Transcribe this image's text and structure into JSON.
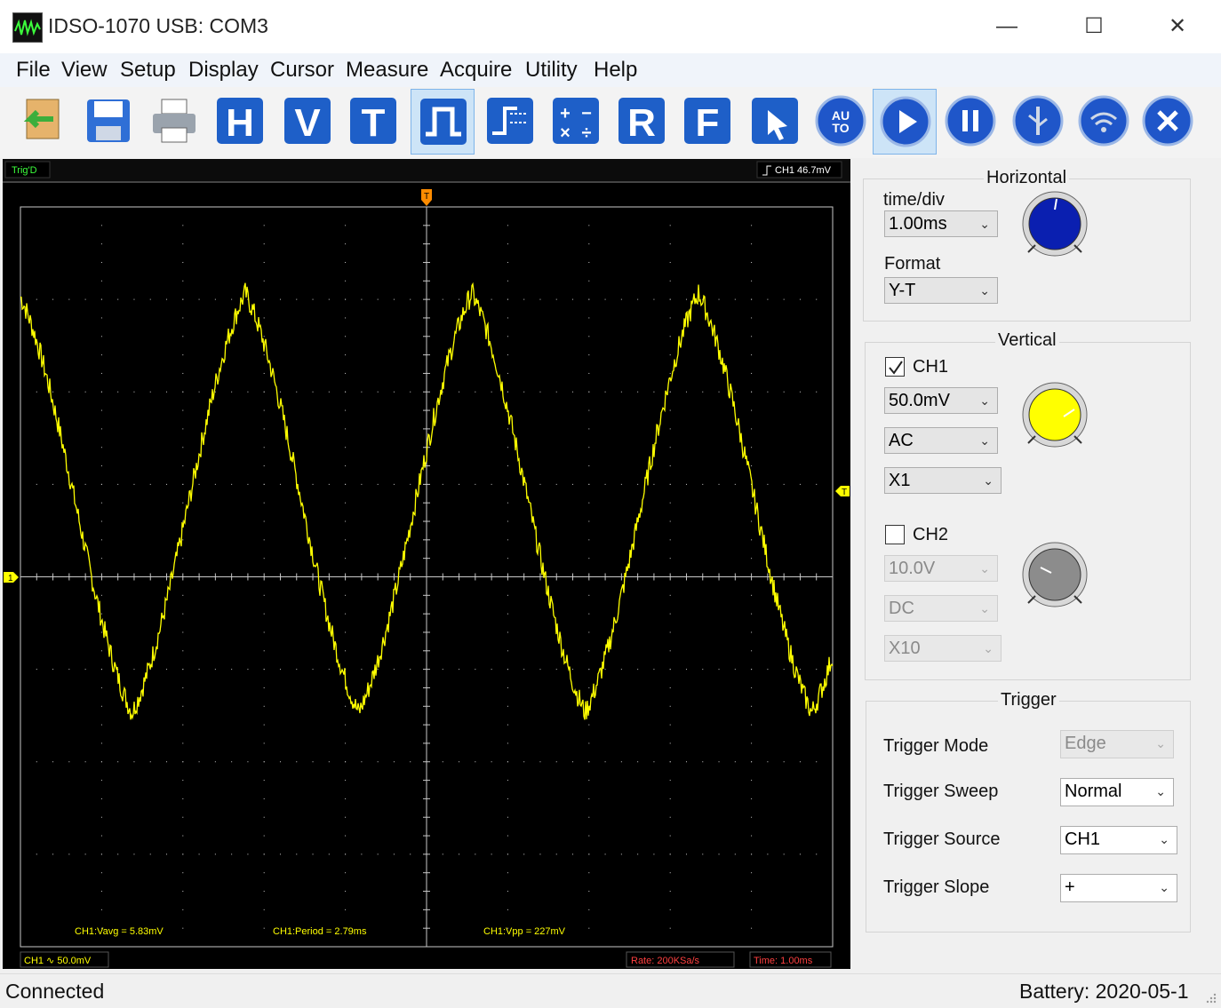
{
  "window": {
    "title": "IDSO-1070  USB: COM3",
    "minimize": "—",
    "maximize": "☐",
    "close": "✕"
  },
  "menu": [
    "File",
    "View",
    "Setup",
    "Display",
    "Cursor",
    "Measure",
    "Acquire",
    "Utility",
    "Help"
  ],
  "toolbar": {
    "buttons": [
      {
        "icon": "open-icon"
      },
      {
        "icon": "save-icon"
      },
      {
        "icon": "print-icon"
      },
      {
        "icon": "horizontal-icon",
        "letter": "H"
      },
      {
        "icon": "vertical-icon",
        "letter": "V"
      },
      {
        "icon": "trigger-icon",
        "letter": "T"
      },
      {
        "icon": "pulse-icon",
        "active": true
      },
      {
        "icon": "math-bars-icon"
      },
      {
        "icon": "math-icon"
      },
      {
        "icon": "reference-icon",
        "letter": "R"
      },
      {
        "icon": "fft-icon",
        "letter": "F"
      },
      {
        "icon": "cursor-icon"
      },
      {
        "icon": "auto-icon",
        "letter": "AUTO"
      },
      {
        "icon": "run-icon",
        "active": true
      },
      {
        "icon": "pause-icon"
      },
      {
        "icon": "usb-icon"
      },
      {
        "icon": "wifi-icon"
      },
      {
        "icon": "exit-icon"
      }
    ]
  },
  "scope": {
    "trig_status": "Trig'D",
    "trigger_readout": "CH1 46.7mV",
    "trigger_marker": "T",
    "ch1_marker": "1",
    "trigger_level_marker": "T",
    "measurements": {
      "vavg": "CH1:Vavg = 5.83mV",
      "period": "CH1:Period = 2.79ms",
      "vpp": "CH1:Vpp = 227mV"
    },
    "footer": {
      "ch1_scale": "CH1 ∿ 50.0mV",
      "rate": "Rate: 200KSa/s",
      "time": "Time: 1.00ms"
    },
    "colors": {
      "trace": "#ffff00",
      "grid": "#c8c8c8",
      "background": "#000000",
      "marker": "#ff8c00"
    },
    "waveform": {
      "shape": "noisy triangle-like",
      "period_ms": 2.79,
      "vpp_mV": 227,
      "volts_per_div_mV": 50.0,
      "time_per_div_ms": 1.0,
      "offset_mV": 5.83
    }
  },
  "horizontal": {
    "legend": "Horizontal",
    "timediv_label": "time/div",
    "timediv_value": "1.00ms",
    "format_label": "Format",
    "format_value": "Y-T",
    "knob_color": "#0a1fb0"
  },
  "vertical": {
    "legend": "Vertical",
    "ch1": {
      "label": "CH1",
      "checked": true,
      "volts": "50.0mV",
      "coupling": "AC",
      "probe": "X1",
      "knob_color": "#ffff00"
    },
    "ch2": {
      "label": "CH2",
      "checked": false,
      "volts": "10.0V",
      "coupling": "DC",
      "probe": "X10",
      "knob_color": "#8c8c8c"
    }
  },
  "trigger": {
    "legend": "Trigger",
    "mode_label": "Trigger Mode",
    "mode_value": "Edge",
    "sweep_label": "Trigger Sweep",
    "sweep_value": "Normal",
    "source_label": "Trigger Source",
    "source_value": "CH1",
    "slope_label": "Trigger Slope",
    "slope_value": "+"
  },
  "status": {
    "left": "Connected",
    "right": "Battery:  2020-05-1"
  }
}
